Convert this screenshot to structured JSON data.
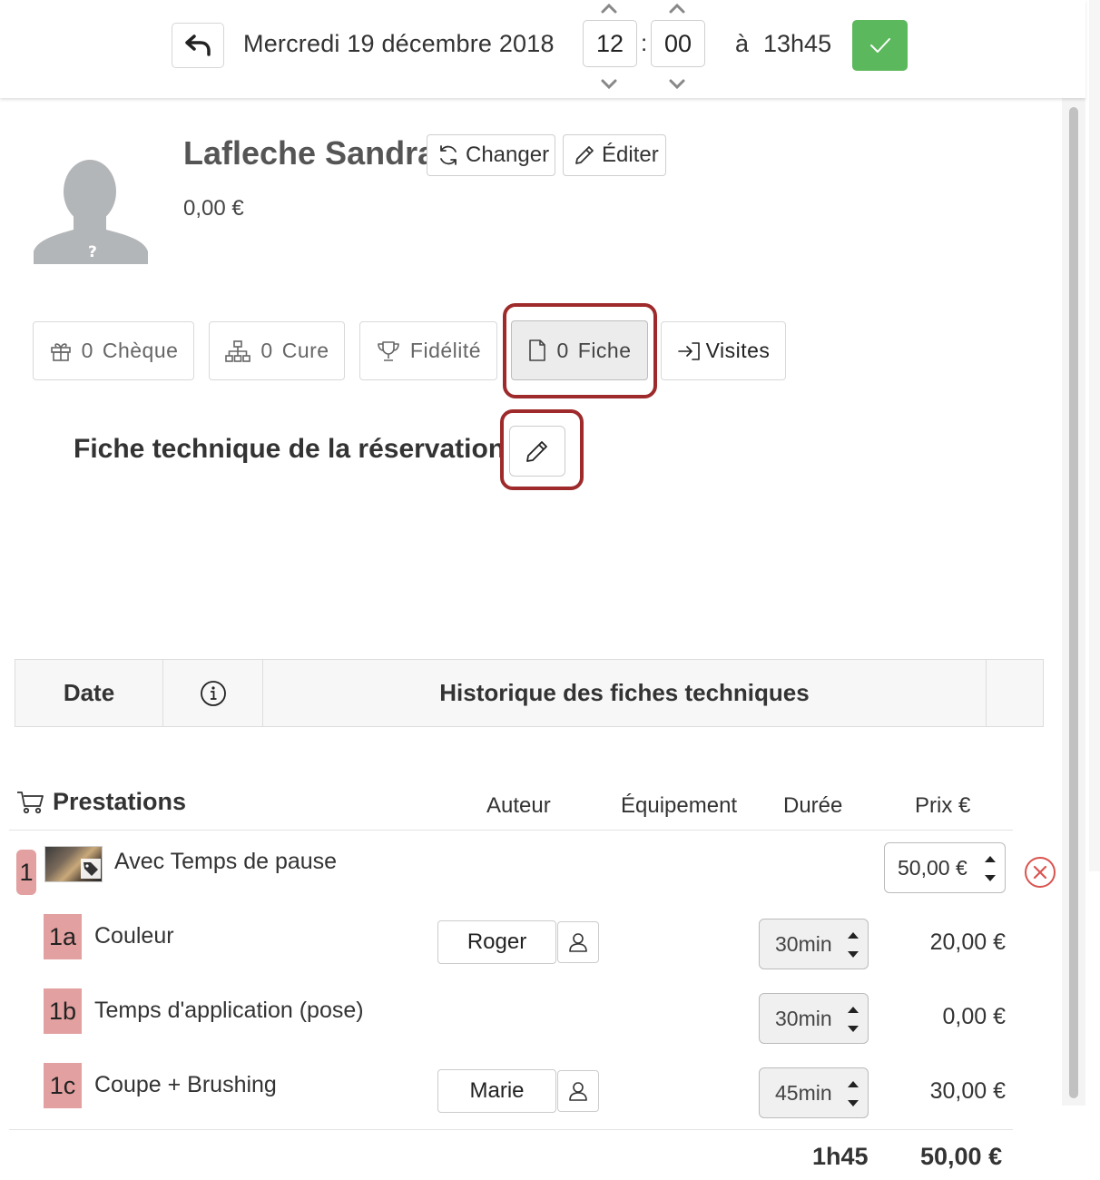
{
  "header": {
    "date": "Mercredi 19 décembre 2018",
    "hour": "12",
    "minute": "00",
    "separator": ":",
    "until_label": "à",
    "end_time": "13h45"
  },
  "client": {
    "name": "Lafleche Sandra",
    "change_label": "Changer",
    "edit_label": "Éditer",
    "balance": "0,00 €",
    "avatar_mark": "?"
  },
  "tabs": [
    {
      "count": "0",
      "label": "Chèque"
    },
    {
      "count": "0",
      "label": "Cure"
    },
    {
      "count": "",
      "label": "Fidélité"
    },
    {
      "count": "0",
      "label": "Fiche"
    },
    {
      "count": "",
      "label": "Visites"
    }
  ],
  "fiche": {
    "title": "Fiche technique de la réservation"
  },
  "history": {
    "columns": [
      "Date",
      "Historique des fiches techniques"
    ]
  },
  "prestations": {
    "title": "Prestations",
    "columns": {
      "author": "Auteur",
      "equipment": "Équipement",
      "duration": "Durée",
      "price": "Prix €"
    },
    "main": {
      "num": "1",
      "name": "Avec Temps de pause",
      "price": "50,00 €"
    },
    "items": [
      {
        "num": "1a",
        "name": "Couleur",
        "author": "Roger",
        "duration": "30min",
        "price": "20,00 €"
      },
      {
        "num": "1b",
        "name": "Temps d'application (pose)",
        "author": "",
        "duration": "30min",
        "price": "0,00 €"
      },
      {
        "num": "1c",
        "name": "Coupe + Brushing",
        "author": "Marie",
        "duration": "45min",
        "price": "30,00 €"
      }
    ],
    "total_duration": "1h45",
    "total_price": "50,00 €"
  },
  "colors": {
    "accent_green": "#5cb85c",
    "highlight_red": "#9e2a2b",
    "badge_pink": "#e2a0a0",
    "remove_red": "#d9534f"
  }
}
